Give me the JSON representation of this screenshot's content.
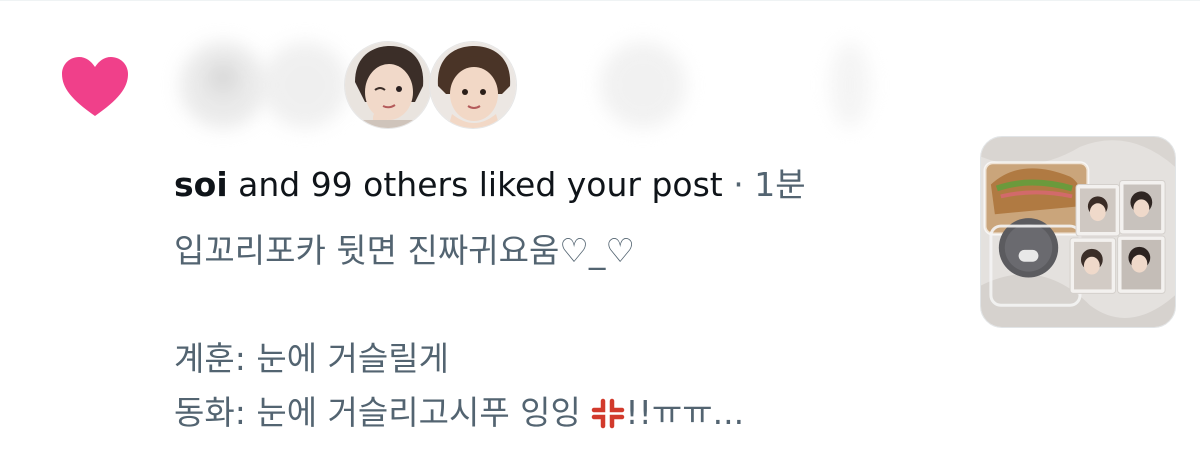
{
  "notification": {
    "type_icon": "heart-icon",
    "heart_color": "#f0408a",
    "liker_username": "soi",
    "liked_text": " and 99 others liked your post",
    "separator": " · ",
    "timestamp": "1분",
    "post_lines": [
      "입꼬리포카 뒷면 진짜귀요움♡_♡",
      "계훈: 눈에 거슬릴게",
      "동화: 눈에 거슬리고시푸 잉잉"
    ],
    "post_line3_suffix": "!!ㅠㅠ...",
    "emoji_icon": "anger-symbol-icon",
    "thumbnail": "post-media-thumbnail"
  }
}
